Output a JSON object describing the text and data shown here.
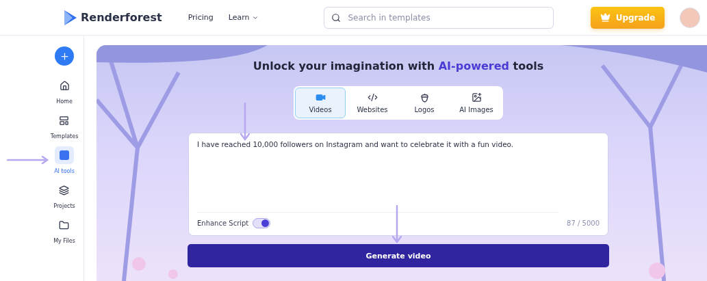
{
  "header": {
    "logo": "Renderforest",
    "nav": [
      {
        "label": "Pricing",
        "kind": "link"
      },
      {
        "label": "Learn",
        "kind": "menu"
      }
    ],
    "search": {
      "placeholder": "Search in templates"
    },
    "upgrade_button": "Upgrade"
  },
  "sidebar": {
    "items": [
      {
        "label": "Home",
        "kind": "home",
        "selected": false
      },
      {
        "label": "Templates",
        "kind": "templates",
        "selected": false
      },
      {
        "label": "AI tools",
        "kind": "ai",
        "selected": true
      },
      {
        "label": "Projects",
        "kind": "layers",
        "selected": false
      },
      {
        "label": "My Files",
        "kind": "folder",
        "selected": false
      }
    ]
  },
  "hero": {
    "title_parts": [
      {
        "text": "Unlock your imagination with ",
        "kind": "plain"
      },
      {
        "text": "AI-powered",
        "kind": "accent"
      },
      {
        "text": " tools",
        "kind": "plain"
      }
    ],
    "tabs": [
      {
        "label": "Videos",
        "kind": "video",
        "selected": true
      },
      {
        "label": "Websites",
        "kind": "code",
        "selected": false
      },
      {
        "label": "Logos",
        "kind": "acorn",
        "selected": false
      },
      {
        "label": "AI Images",
        "kind": "image",
        "selected": false
      }
    ],
    "prompt": {
      "value": "I have reached 10,000 followers on Instagram and want to celebrate it with a fun video.",
      "enhance_label": "Enhance Script",
      "enhance_on": true,
      "counter": "87 / 5000"
    },
    "generate_button": "Generate video"
  }
}
